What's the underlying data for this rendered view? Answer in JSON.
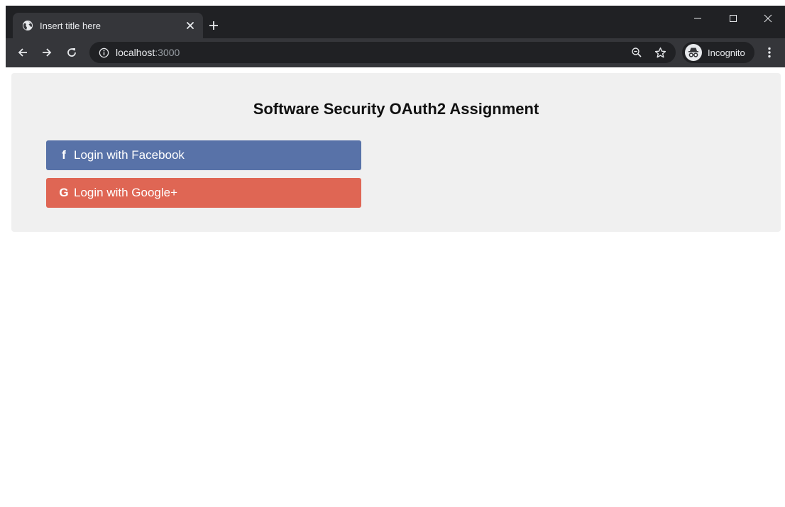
{
  "browser": {
    "tab": {
      "title": "Insert title here",
      "favicon": "globe-icon",
      "close_icon": "close-icon"
    },
    "new_tab_icon": "plus-icon",
    "window_controls": [
      "minimize-icon",
      "maximize-icon",
      "close-icon"
    ],
    "toolbar": {
      "back_icon": "arrow-left-icon",
      "forward_icon": "arrow-right-icon",
      "reload_icon": "reload-icon",
      "address": {
        "info_icon": "info-icon",
        "host": "localhost",
        "port": ":3000",
        "zoom_icon": "zoom-out-icon",
        "bookmark_icon": "star-icon"
      },
      "profile": {
        "icon": "incognito-icon",
        "label": "Incognito"
      },
      "menu_icon": "kebab-menu-icon"
    },
    "colors": {
      "frame": "#202124",
      "toolbar": "#35363a"
    }
  },
  "page": {
    "title": "Software Security OAuth2 Assignment",
    "buttons": [
      {
        "label": "Login with Facebook",
        "icon_glyph": "f",
        "icon": "facebook-icon",
        "color": "#5872a8"
      },
      {
        "label": "Login with Google+",
        "icon_glyph": "G",
        "icon": "google-icon",
        "color": "#df6654"
      }
    ],
    "panel_color": "#f0f0f0"
  }
}
